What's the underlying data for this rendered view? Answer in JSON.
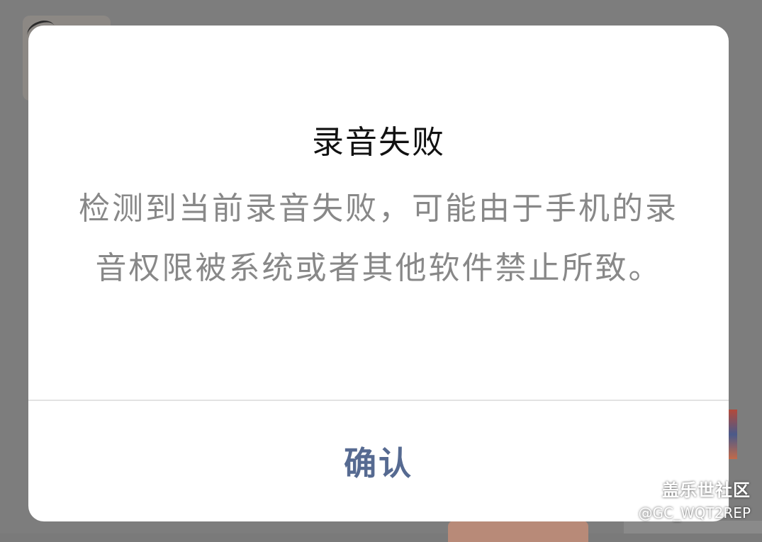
{
  "dialog": {
    "title": "录音失败",
    "message": "检测到当前录音失败，可能由于手机的录音权限被系统或者其他软件禁止所致。",
    "confirm_label": "确认"
  },
  "watermark": {
    "brand": "盖乐世社区",
    "handle": "@GC_WQT2REP"
  },
  "colors": {
    "overlay": "#7a7a7a",
    "title": "#111111",
    "message": "#888888",
    "confirm": "#566a91",
    "divider": "#e2e2e2"
  }
}
